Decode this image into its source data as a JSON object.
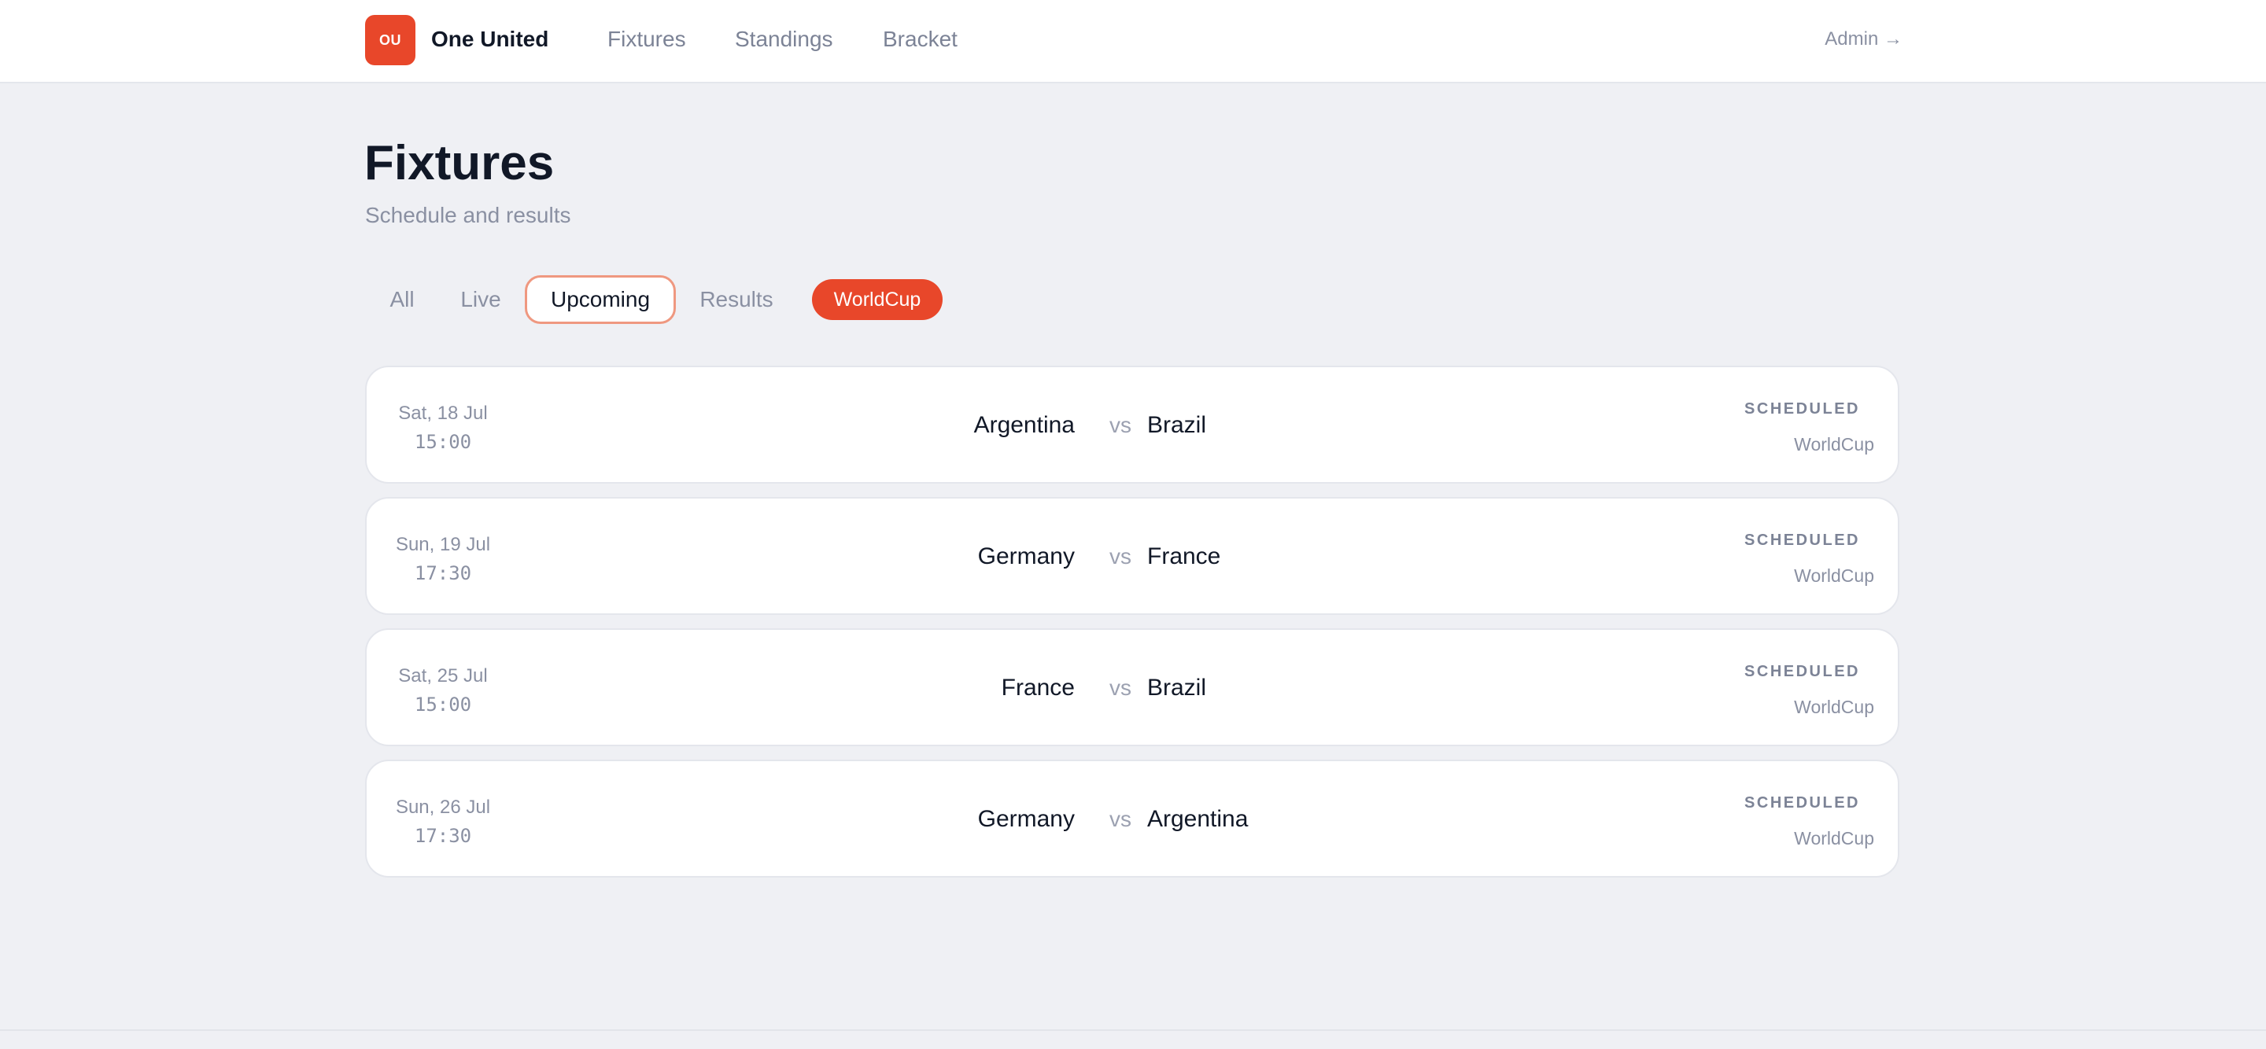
{
  "brand": {
    "logo_text": "OU",
    "name": "One United",
    "accent": "#e8472a"
  },
  "nav": {
    "fixtures": "Fixtures",
    "standings": "Standings",
    "bracket": "Bracket",
    "admin": "Admin →"
  },
  "page": {
    "title": "Fixtures",
    "subtitle": "Schedule and results"
  },
  "filters": {
    "tabs": [
      "All",
      "Live",
      "Upcoming",
      "Results"
    ],
    "active_tab": "Upcoming",
    "competition": "WorldCup"
  },
  "fixtures": [
    {
      "date": "Sat, 18 Jul",
      "time": "15:00",
      "home": "Argentina",
      "vs": "vs",
      "away": "Brazil",
      "status": "SCHEDULED",
      "competition": "WorldCup"
    },
    {
      "date": "Sun, 19 Jul",
      "time": "17:30",
      "home": "Germany",
      "vs": "vs",
      "away": "France",
      "status": "SCHEDULED",
      "competition": "WorldCup"
    },
    {
      "date": "Sat, 25 Jul",
      "time": "15:00",
      "home": "France",
      "vs": "vs",
      "away": "Brazil",
      "status": "SCHEDULED",
      "competition": "WorldCup"
    },
    {
      "date": "Sun, 26 Jul",
      "time": "17:30",
      "home": "Germany",
      "vs": "vs",
      "away": "Argentina",
      "status": "SCHEDULED",
      "competition": "WorldCup"
    }
  ]
}
